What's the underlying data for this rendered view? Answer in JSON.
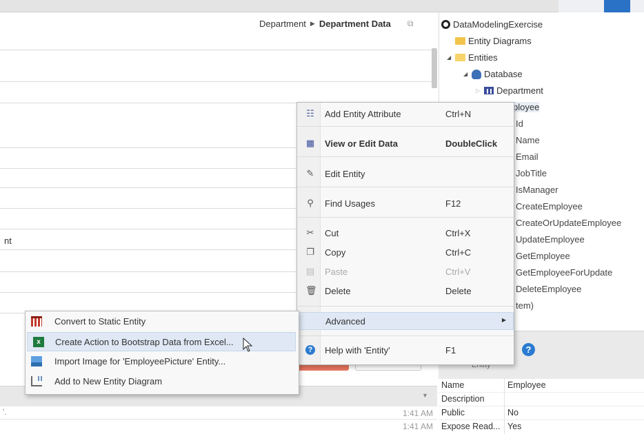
{
  "breadcrumb": {
    "parent": "Department",
    "current": "Department Data"
  },
  "main": {
    "partial_row_text": "nt",
    "bottom_rows": [
      {
        "tick": "'.",
        "time": "1:41 AM"
      },
      {
        "tick": "",
        "time": "1:41 AM"
      }
    ]
  },
  "tree": {
    "root": "DataModelingExercise",
    "entity_diagrams": "Entity Diagrams",
    "entities": "Entities",
    "database": "Database",
    "department": "Department",
    "employee_partial": "ployee",
    "attributes": [
      "Id",
      "Name",
      "Email",
      "JobTitle",
      "IsManager",
      "CreateEmployee",
      "CreateOrUpdateEmployee",
      "UpdateEmployee",
      "GetEmployee",
      "GetEmployeeForUpdate",
      "DeleteEmployee",
      "tem)"
    ]
  },
  "properties": {
    "header_label": "Entity",
    "help_glyph": "?",
    "rows": [
      {
        "name": "Name",
        "value": "Employee"
      },
      {
        "name": "Description",
        "value": ""
      },
      {
        "name": "Public",
        "value": "No"
      },
      {
        "name": "Expose Read...",
        "value": "Yes"
      }
    ]
  },
  "context_menu": {
    "items": [
      {
        "label": "Add Entity Attribute",
        "shortcut": "Ctrl+N",
        "icon": "attribute-icon"
      },
      {
        "label": "View or Edit Data",
        "shortcut": "DoubleClick",
        "icon": "grid-icon"
      },
      {
        "label": "Edit Entity",
        "shortcut": "",
        "icon": "pencil-icon"
      },
      {
        "label": "Find Usages",
        "shortcut": "F12",
        "icon": "magnifier-icon"
      },
      {
        "label": "Cut",
        "shortcut": "Ctrl+X",
        "icon": "scissors-icon"
      },
      {
        "label": "Copy",
        "shortcut": "Ctrl+C",
        "icon": "copy-icon"
      },
      {
        "label": "Paste",
        "shortcut": "Ctrl+V",
        "icon": "paste-icon"
      },
      {
        "label": "Delete",
        "shortcut": "Delete",
        "icon": "trash-icon"
      },
      {
        "label": "Advanced",
        "shortcut": "",
        "icon": ""
      },
      {
        "label": "Help with 'Entity'",
        "shortcut": "F1",
        "icon": "help-icon"
      }
    ]
  },
  "submenu": {
    "items": [
      {
        "label": "Convert to Static Entity",
        "icon": "static-entity-icon"
      },
      {
        "label": "Create Action to Bootstrap Data from Excel...",
        "icon": "excel-icon"
      },
      {
        "label": "Import Image for 'EmployeePicture' Entity...",
        "icon": "image-icon"
      },
      {
        "label": "Add to New Entity Diagram",
        "icon": "diagram-icon"
      }
    ]
  },
  "colors": {
    "accent": "#2a72c6",
    "menu_hover": "#dfe8f4",
    "excel_green": "#1e7b3d",
    "delete_red": "#e9765f"
  }
}
